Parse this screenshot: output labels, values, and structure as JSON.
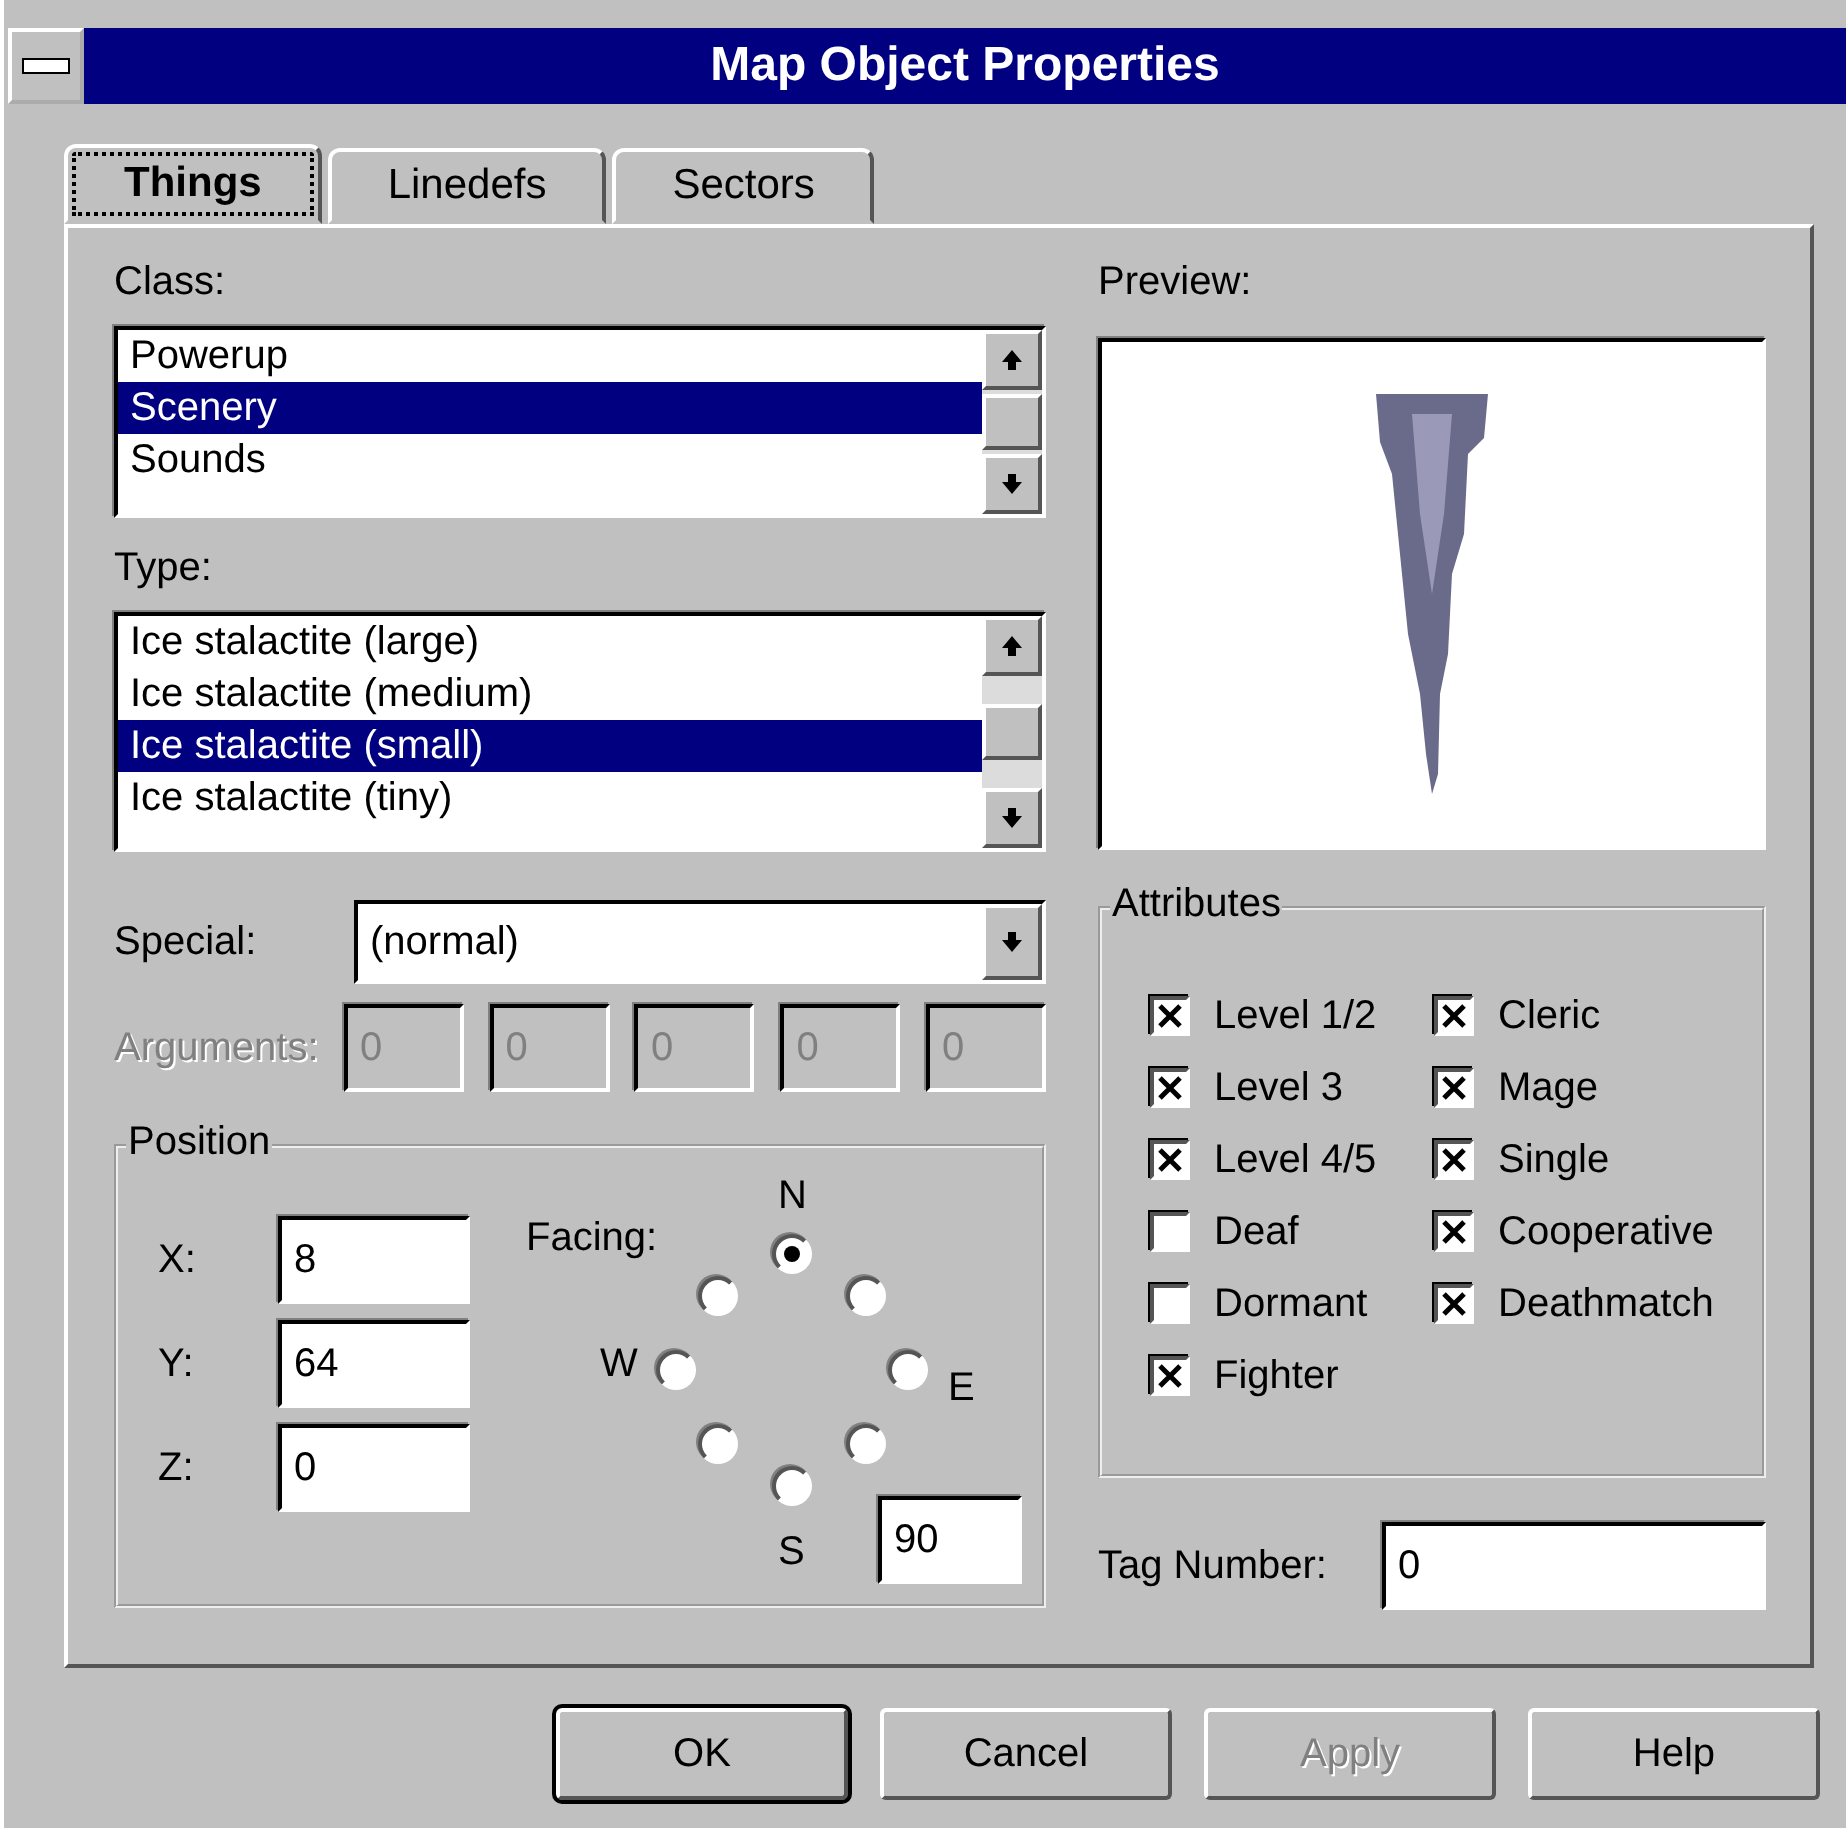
{
  "window": {
    "title": "Map Object Properties"
  },
  "tabs": [
    {
      "label": "Things",
      "selected": true
    },
    {
      "label": "Linedefs",
      "selected": false
    },
    {
      "label": "Sectors",
      "selected": false
    }
  ],
  "class_list": {
    "label": "Class:",
    "items": [
      {
        "label": "Powerup",
        "selected": false
      },
      {
        "label": "Scenery",
        "selected": true
      },
      {
        "label": "Sounds",
        "selected": false
      }
    ]
  },
  "type_list": {
    "label": "Type:",
    "items": [
      {
        "label": "Ice stalactite (large)",
        "selected": false
      },
      {
        "label": "Ice stalactite (medium)",
        "selected": false
      },
      {
        "label": "Ice stalactite (small)",
        "selected": true
      },
      {
        "label": "Ice stalactite (tiny)",
        "selected": false
      }
    ]
  },
  "special": {
    "label": "Special:",
    "value": "(normal)"
  },
  "arguments": {
    "label": "Arguments:",
    "disabled": true,
    "values": [
      "0",
      "0",
      "0",
      "0",
      "0"
    ]
  },
  "position": {
    "title": "Position",
    "fields": [
      {
        "label": "X:",
        "value": "8"
      },
      {
        "label": "Y:",
        "value": "64"
      },
      {
        "label": "Z:",
        "value": "0"
      }
    ],
    "facing": {
      "label": "Facing:",
      "compass": [
        "N",
        "E",
        "S",
        "W"
      ],
      "angle": "90",
      "options": [
        {
          "selected": true
        },
        {
          "selected": false
        },
        {
          "selected": false
        },
        {
          "selected": false
        },
        {
          "selected": false
        },
        {
          "selected": false
        },
        {
          "selected": false
        },
        {
          "selected": false
        }
      ]
    }
  },
  "preview": {
    "label": "Preview:"
  },
  "attributes": {
    "title": "Attributes",
    "items": [
      {
        "label": "Level 1/2",
        "checked": true
      },
      {
        "label": "Cleric",
        "checked": true
      },
      {
        "label": "Level 3",
        "checked": true
      },
      {
        "label": "Mage",
        "checked": true
      },
      {
        "label": "Level 4/5",
        "checked": true
      },
      {
        "label": "Single",
        "checked": true
      },
      {
        "label": "Deaf",
        "checked": false
      },
      {
        "label": "Cooperative",
        "checked": true
      },
      {
        "label": "Dormant",
        "checked": false
      },
      {
        "label": "Deathmatch",
        "checked": true
      },
      {
        "label": "Fighter",
        "checked": true
      }
    ]
  },
  "tag_number": {
    "label": "Tag Number:",
    "value": "0"
  },
  "buttons": [
    {
      "label": "OK",
      "default": true,
      "disabled": false
    },
    {
      "label": "Cancel",
      "default": false,
      "disabled": false
    },
    {
      "label": "Apply",
      "default": false,
      "disabled": true
    },
    {
      "label": "Help",
      "default": false,
      "disabled": false
    }
  ]
}
